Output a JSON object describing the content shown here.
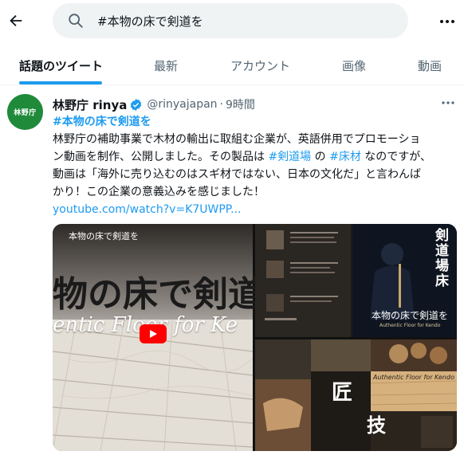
{
  "search": {
    "query": "#本物の床で剣道を"
  },
  "tabs": [
    {
      "label": "話題のツイート",
      "active": true
    },
    {
      "label": "最新",
      "active": false
    },
    {
      "label": "アカウント",
      "active": false
    },
    {
      "label": "画像",
      "active": false
    },
    {
      "label": "動画",
      "active": false
    }
  ],
  "tweet": {
    "avatar_text": "林野庁",
    "display_name": "林野庁 rinya",
    "handle": "@rinyajapan",
    "time": "9時間",
    "title_hashtag": "#本物の床で剣道を",
    "line1": "林野庁の補助事業で木材の輸出に取組む企業が、英語併用でプロモーショ",
    "line2": "ン動画を制作、公開しました。その製品は",
    "hashtag_kendojo": "#剣道場",
    "line2_mid": "の",
    "hashtag_yukazai": "#床材",
    "line2_end": "なのですが、",
    "line3": "動画は「海外に売り込むのはスギ材ではない、日本の文化だ」と言わんば",
    "line4": "かり！この企業の意義込みを感じました！",
    "link": "youtube.com/watch?v=K7UWPP..."
  },
  "media": {
    "video_title": "本物の床で剣道を",
    "video_calligraphy": "物の床で剣道",
    "video_english": "entic Floor for Ke",
    "poster_vertical": "剣道場床",
    "poster_caption": "本物の床で剣道を",
    "poster_caption_en": "Authentic Floor for Kendo",
    "brochure_title_en": "Authentic Floor for Kendo",
    "brochure_kanji_1": "匠",
    "brochure_kanji_2": "技"
  }
}
